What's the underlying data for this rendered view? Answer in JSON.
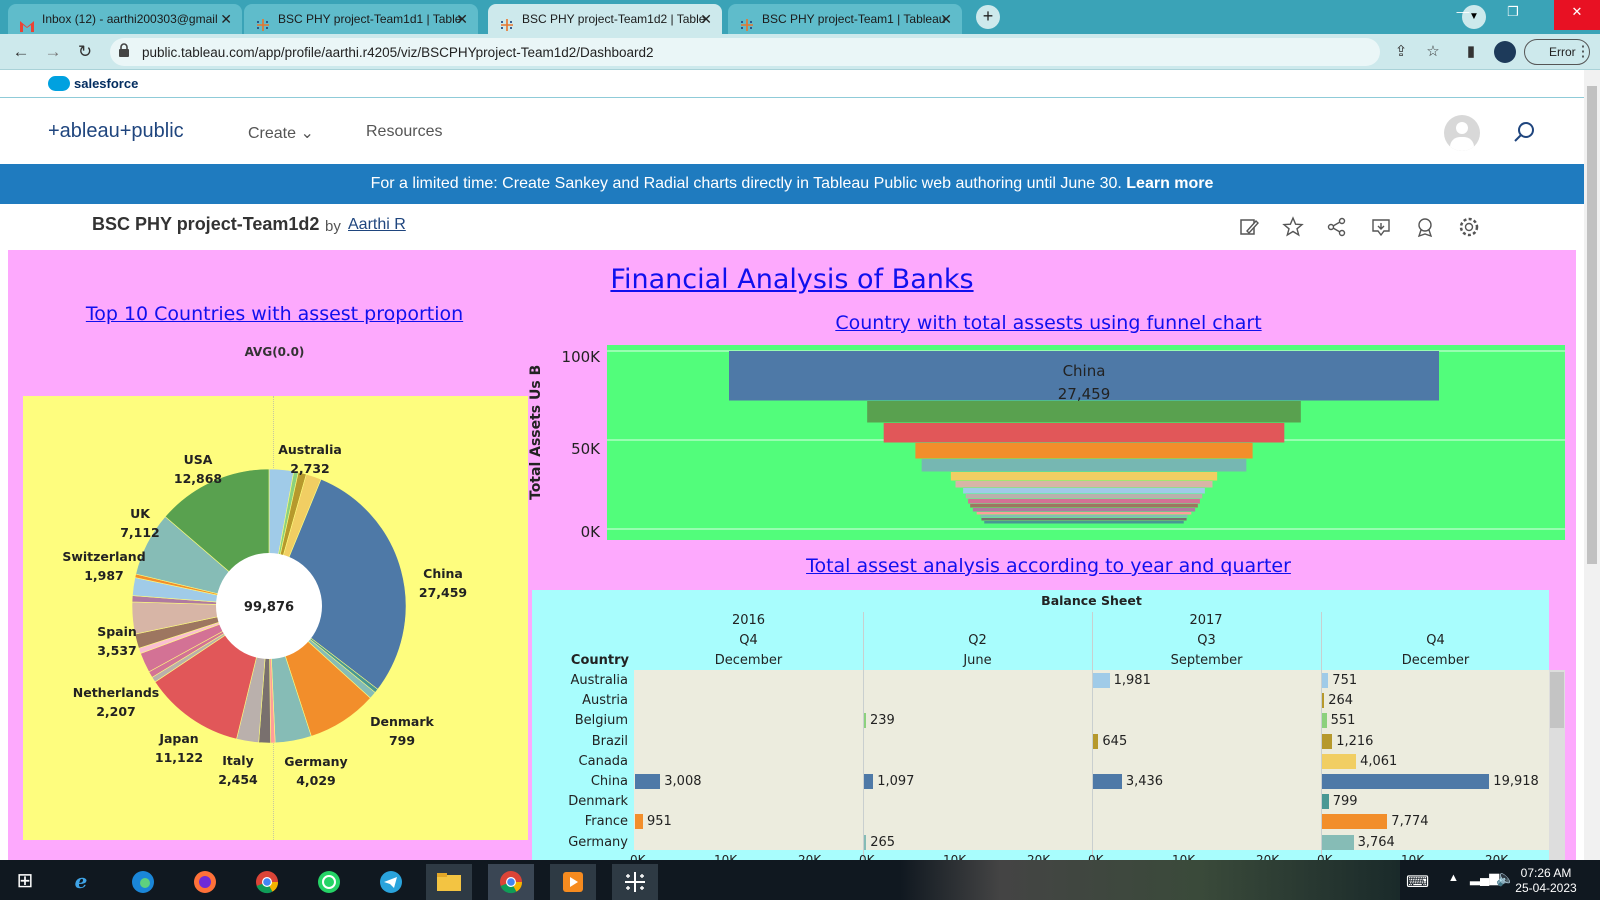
{
  "browser": {
    "tabs": [
      {
        "title": "Inbox (12) - aarthi200303@gmail",
        "icon": "gmail-icon"
      },
      {
        "title": "BSC PHY project-Team1d1 | Table",
        "icon": "tableau-icon"
      },
      {
        "title": "BSC PHY project-Team1d2 | Table",
        "icon": "tableau-icon"
      },
      {
        "title": "BSC PHY project-Team1 | Tableau",
        "icon": "tableau-icon"
      }
    ],
    "active_tab": 2,
    "url": "public.tableau.com/app/profile/aarthi.r4205/viz/BSCPHYproject-Team1d2/Dashboard2",
    "error_label": "Error"
  },
  "site": {
    "salesforce": "salesforce",
    "logo": "+ableau+public",
    "nav": {
      "create": "Create",
      "resources": "Resources"
    },
    "banner_text": "For a limited time: Create Sankey and Radial charts directly in Tableau Public web authoring until June 30.",
    "banner_link": "Learn more",
    "viz_title": "BSC PHY project-Team1d2",
    "by": "by",
    "author": "Aarthi R"
  },
  "dashboard": {
    "title": "Financial Analysis of Banks",
    "pie_title": "Top 10 Countries with assest proportion",
    "pie_sub": "AVG(0.0)",
    "pie_total": "99,876",
    "funnel_title": "Country with total assests using funnel chart",
    "funnel_ylabel": "Total Assets Us B",
    "funnel_ticks": [
      "100K",
      "50K",
      "0K"
    ],
    "funnel_top_label": "China",
    "funnel_top_value": "27,459",
    "table_title": "Total assest analysis according to year and quarter",
    "table_header": "Balance Sheet",
    "country_header": "Country",
    "years": [
      "2016",
      "2017"
    ],
    "quarters": [
      "Q4",
      "Q2",
      "Q3",
      "Q4"
    ],
    "months": [
      "December",
      "June",
      "September",
      "December"
    ],
    "axis_ticks": [
      "0K",
      "10K",
      "20K"
    ]
  },
  "chart_data": [
    {
      "type": "pie",
      "title": "Top 10 Countries with assest proportion",
      "center_label": "99,876",
      "slices": [
        {
          "label": "Australia",
          "value": 2732,
          "color": "#a0cbe8"
        },
        {
          "label": "",
          "value": 500,
          "color": "#8cd17d"
        },
        {
          "label": "",
          "value": 900,
          "color": "#b6992d"
        },
        {
          "label": "",
          "value": 1700,
          "color": "#f1ce63"
        },
        {
          "label": "China",
          "value": 27459,
          "color": "#4e79a7"
        },
        {
          "label": "",
          "value": 450,
          "color": "#499894"
        },
        {
          "label": "Denmark",
          "value": 799,
          "color": "#86bcb6"
        },
        {
          "label": "",
          "value": 7774,
          "color": "#f28e2b"
        },
        {
          "label": "Germany",
          "value": 4029,
          "color": "#86bcb6"
        },
        {
          "label": "",
          "value": 500,
          "color": "#ff9d9a"
        },
        {
          "label": "",
          "value": 1300,
          "color": "#79706e"
        },
        {
          "label": "Italy",
          "value": 2454,
          "color": "#bab0ac"
        },
        {
          "label": "Japan",
          "value": 11122,
          "color": "#e15759"
        },
        {
          "label": "",
          "value": 600,
          "color": "#bab0ac"
        },
        {
          "label": "",
          "value": 700,
          "color": "#d37295"
        },
        {
          "label": "Netherlands",
          "value": 2207,
          "color": "#d37295"
        },
        {
          "label": "",
          "value": 600,
          "color": "#fabfd2"
        },
        {
          "label": "",
          "value": 1600,
          "color": "#9d7660"
        },
        {
          "label": "Spain",
          "value": 3537,
          "color": "#d7b5a6"
        },
        {
          "label": "",
          "value": 700,
          "color": "#b07aa1"
        },
        {
          "label": "Switzerland",
          "value": 1987,
          "color": "#a0cbe8"
        },
        {
          "label": "",
          "value": 400,
          "color": "#f28e2b"
        },
        {
          "label": "UK",
          "value": 7112,
          "color": "#86bcb6"
        },
        {
          "label": "USA",
          "value": 12868,
          "color": "#59a14f"
        }
      ],
      "labels": [
        {
          "label": "Australia",
          "value": "2,732"
        },
        {
          "label": "China",
          "value": "27,459"
        },
        {
          "label": "Denmark",
          "value": "799"
        },
        {
          "label": "Germany",
          "value": "4,029"
        },
        {
          "label": "Italy",
          "value": "2,454"
        },
        {
          "label": "Japan",
          "value": "11,122"
        },
        {
          "label": "Netherlands",
          "value": "2,207"
        },
        {
          "label": "Spain",
          "value": "3,537"
        },
        {
          "label": "Switzerland",
          "value": "1,987"
        },
        {
          "label": "UK",
          "value": "7,112"
        },
        {
          "label": "USA",
          "value": "12,868"
        }
      ]
    },
    {
      "type": "bar",
      "subtype": "funnel",
      "title": "Country with total assests using funnel chart",
      "ylabel": "Total Assets Us B",
      "ylim": [
        0,
        100000
      ],
      "series": [
        {
          "values": [
            27459,
            12868,
            11122,
            7774,
            7112,
            4029,
            3537,
            2732,
            2454,
            2207,
            1987,
            1700,
            1300,
            900,
            799,
            500
          ],
          "colors": [
            "#4e79a7",
            "#59a14f",
            "#e15759",
            "#f28e2b",
            "#76b7b2",
            "#f1ce63",
            "#d7b5a6",
            "#a0cbe8",
            "#bab0ac",
            "#d37295",
            "#9d7660",
            "#b07aa1",
            "#ff9d9a",
            "#86bcb6",
            "#79706e",
            "#499894"
          ]
        }
      ],
      "top_label": "China",
      "top_value": "27,459"
    },
    {
      "type": "bar",
      "subtype": "table",
      "title": "Total assest analysis according to year and quarter",
      "columns": [
        "2016 Q4 December",
        "2017 Q2 June",
        "2017 Q3 September",
        "2017 Q4 December"
      ],
      "xlim": [
        0,
        22000
      ],
      "rows": [
        {
          "country": "Australia",
          "color": "#a0cbe8",
          "values": [
            null,
            null,
            1981,
            751
          ]
        },
        {
          "country": "Austria",
          "color": "#b6992d",
          "values": [
            null,
            null,
            null,
            264
          ]
        },
        {
          "country": "Belgium",
          "color": "#8cd17d",
          "values": [
            null,
            239,
            null,
            551
          ]
        },
        {
          "country": "Brazil",
          "color": "#b6992d",
          "values": [
            null,
            null,
            645,
            1216
          ]
        },
        {
          "country": "Canada",
          "color": "#f1ce63",
          "values": [
            null,
            null,
            null,
            4061
          ]
        },
        {
          "country": "China",
          "color": "#4e79a7",
          "values": [
            3008,
            1097,
            3436,
            19918
          ]
        },
        {
          "country": "Denmark",
          "color": "#499894",
          "values": [
            null,
            null,
            null,
            799
          ]
        },
        {
          "country": "France",
          "color": "#f28e2b",
          "values": [
            951,
            null,
            null,
            7774
          ]
        },
        {
          "country": "Germany",
          "color": "#86bcb6",
          "values": [
            null,
            265,
            null,
            3764
          ]
        }
      ]
    }
  ]
}
